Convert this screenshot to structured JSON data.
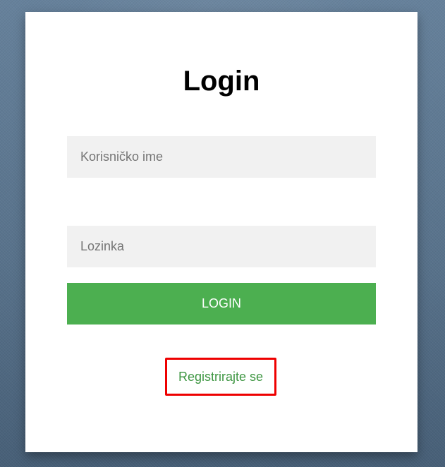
{
  "login_form": {
    "title": "Login",
    "username": {
      "placeholder": "Korisničko ime",
      "value": ""
    },
    "password": {
      "placeholder": "Lozinka",
      "value": ""
    },
    "submit_label": "LOGIN",
    "register_link": "Registrirajte se"
  },
  "colors": {
    "background": "#5b7690",
    "card": "#ffffff",
    "input_background": "#f1f1f1",
    "button": "#4caf50",
    "link": "#3e9642",
    "highlight_border": "#ee0000"
  }
}
